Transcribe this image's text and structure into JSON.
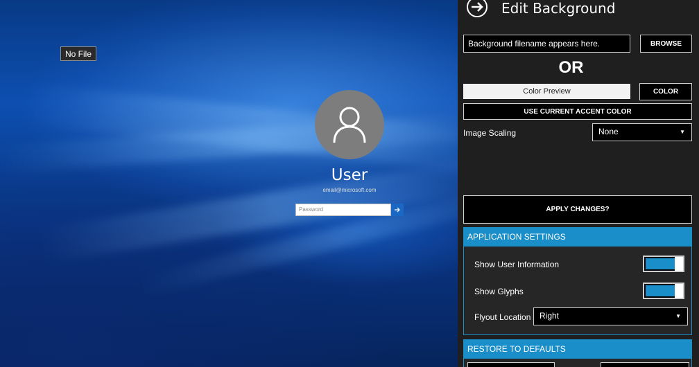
{
  "preview": {
    "file_badge": "No File",
    "user_name": "User",
    "user_email": "email@microsoft.com",
    "password_placeholder": "Password"
  },
  "panel": {
    "title": "Edit Background",
    "background_filename": "Background filename appears here.",
    "browse_label": "BROWSE",
    "or_label": "OR",
    "color_preview_label": "Color Preview",
    "color_label": "COLOR",
    "accent_label": "USE CURRENT ACCENT COLOR",
    "image_scaling_label": "Image Scaling",
    "image_scaling_value": "None",
    "apply_label": "APPLY CHANGES?"
  },
  "app_settings": {
    "title": "APPLICATION SETTINGS",
    "show_user_info_label": "Show User Information",
    "show_user_info_on": true,
    "show_glyphs_label": "Show Glyphs",
    "show_glyphs_on": true,
    "flyout_location_label": "Flyout Location",
    "flyout_location_value": "Right"
  },
  "restore": {
    "title": "RESTORE TO DEFAULTS"
  },
  "colors": {
    "accent": "#1a8ec9",
    "panel_bg": "#1f1f1f",
    "avatar_bg": "#7d7d7d"
  }
}
